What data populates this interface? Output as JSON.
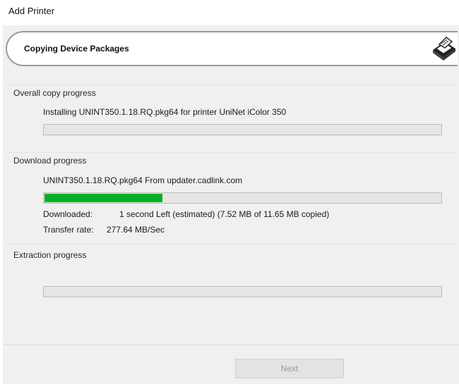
{
  "window": {
    "title": "Add Printer"
  },
  "header": {
    "title": "Copying Device Packages",
    "icon": "printer-icon"
  },
  "overall": {
    "label": "Overall copy progress",
    "status": "Installing UNINT350.1.18.RQ.pkg64 for printer UniNet iColor 350",
    "progress": 0
  },
  "download": {
    "label": "Download progress",
    "status": "UNINT350.1.18.RQ.pkg64 From updater.cadlink.com",
    "progress": 0.3,
    "downloaded_label": "Downloaded:",
    "downloaded_value": "1 second Left (estimated) (7.52 MB of 11.65 MB copied)",
    "rate_label": "Transfer rate:",
    "rate_value": "277.64 MB/Sec"
  },
  "extraction": {
    "label": "Extraction progress",
    "progress": 0
  },
  "footer": {
    "next_label": "Next"
  },
  "colors": {
    "progress_fill": "#06b025",
    "header_border": "#9a9a9a",
    "background": "#f0f0f0"
  }
}
